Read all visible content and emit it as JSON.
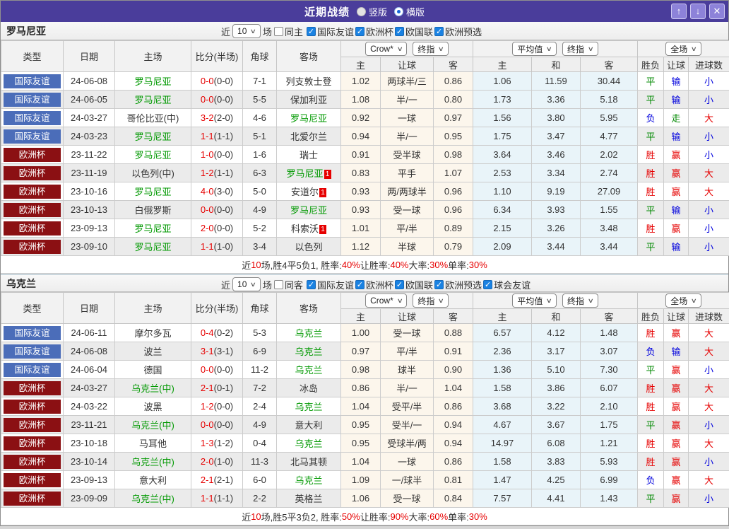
{
  "titlebar": {
    "title": "近期战绩",
    "vertical_label": "竖版",
    "horizontal_label": "横版",
    "icons": {
      "up": "↑",
      "down": "↓",
      "close": "✕"
    }
  },
  "colors": {
    "titlebar_purple": "#4a3d9b",
    "friendly_blue": "#4b6db9",
    "eurocup_darkred": "#8b1013",
    "team_green": "#009900",
    "win_red": "#e60000",
    "lose_blue": "#0000dd",
    "draw_green": "#008800",
    "handicap_tint": "#fcf6ec",
    "average_tint": "#e9f4f9"
  },
  "table_header": {
    "col_type": "类型",
    "col_date": "日期",
    "col_home": "主场",
    "col_score": "比分(半场)",
    "col_corner": "角球",
    "col_away": "客场",
    "dd_book": "Crow*",
    "dd_final1": "终指",
    "dd_avg": "平均值",
    "dd_final2": "终指",
    "dd_scope": "全场",
    "sub_home": "主",
    "sub_handicap": "让球",
    "sub_away": "客",
    "sub_avg_home": "主",
    "sub_avg_draw": "和",
    "sub_avg_away": "客",
    "sub_wdl": "胜负",
    "sub_ah": "让球",
    "sub_goals": "进球数"
  },
  "sections": [
    {
      "team": "罗马尼亚",
      "filter": {
        "near_label": "近",
        "count": "10",
        "games_label": "场",
        "same_label": "同主",
        "competitions": [
          "国际友谊",
          "欧洲杯",
          "欧国联",
          "欧洲预选"
        ]
      },
      "rows": [
        {
          "comp": "国际友谊",
          "comp_style": "friendly",
          "date": "24-06-08",
          "home": "罗马尼亚",
          "home_hl": true,
          "away": "列支敦士登",
          "away_hl": false,
          "ft": "0-0",
          "ht": "(0-0)",
          "corner": "7-1",
          "oh": "1.02",
          "hc": "两球半/三",
          "oa": "0.86",
          "ah": "1.06",
          "ad": "11.59",
          "aa": "30.44",
          "wdl": "平",
          "wdl_c": "g",
          "rah": "输",
          "rah_c": "b",
          "ou": "小",
          "ou_c": "b"
        },
        {
          "comp": "国际友谊",
          "comp_style": "friendly",
          "date": "24-06-05",
          "home": "罗马尼亚",
          "home_hl": true,
          "away": "保加利亚",
          "away_hl": false,
          "ft": "0-0",
          "ht": "(0-0)",
          "corner": "5-5",
          "oh": "1.08",
          "hc": "半/一",
          "oa": "0.80",
          "ah": "1.73",
          "ad": "3.36",
          "aa": "5.18",
          "wdl": "平",
          "wdl_c": "g",
          "rah": "输",
          "rah_c": "b",
          "ou": "小",
          "ou_c": "b"
        },
        {
          "comp": "国际友谊",
          "comp_style": "friendly",
          "date": "24-03-27",
          "home": "哥伦比亚(中)",
          "home_hl": false,
          "away": "罗马尼亚",
          "away_hl": true,
          "ft": "3-2",
          "ht": "(2-0)",
          "corner": "4-6",
          "oh": "0.92",
          "hc": "一球",
          "oa": "0.97",
          "ah": "1.56",
          "ad": "3.80",
          "aa": "5.95",
          "wdl": "负",
          "wdl_c": "b",
          "rah": "走",
          "rah_c": "g",
          "ou": "大",
          "ou_c": "r"
        },
        {
          "comp": "国际友谊",
          "comp_style": "friendly",
          "date": "24-03-23",
          "home": "罗马尼亚",
          "home_hl": true,
          "away": "北爱尔兰",
          "away_hl": false,
          "ft": "1-1",
          "ht": "(1-1)",
          "corner": "5-1",
          "oh": "0.94",
          "hc": "半/一",
          "oa": "0.95",
          "ah": "1.75",
          "ad": "3.47",
          "aa": "4.77",
          "wdl": "平",
          "wdl_c": "g",
          "rah": "输",
          "rah_c": "b",
          "ou": "小",
          "ou_c": "b"
        },
        {
          "comp": "欧洲杯",
          "comp_style": "euro",
          "date": "23-11-22",
          "home": "罗马尼亚",
          "home_hl": true,
          "away": "瑞士",
          "away_hl": false,
          "ft": "1-0",
          "ht": "(0-0)",
          "corner": "1-6",
          "oh": "0.91",
          "hc": "受半球",
          "oa": "0.98",
          "ah": "3.64",
          "ad": "3.46",
          "aa": "2.02",
          "wdl": "胜",
          "wdl_c": "r",
          "rah": "赢",
          "rah_c": "r",
          "ou": "小",
          "ou_c": "b"
        },
        {
          "comp": "欧洲杯",
          "comp_style": "euro",
          "date": "23-11-19",
          "home": "以色列(中)",
          "home_hl": false,
          "away": "罗马尼亚",
          "away_hl": true,
          "away_card": "1",
          "ft": "1-2",
          "ht": "(1-1)",
          "corner": "6-3",
          "oh": "0.83",
          "hc": "平手",
          "oa": "1.07",
          "ah": "2.53",
          "ad": "3.34",
          "aa": "2.74",
          "wdl": "胜",
          "wdl_c": "r",
          "rah": "赢",
          "rah_c": "r",
          "ou": "大",
          "ou_c": "r"
        },
        {
          "comp": "欧洲杯",
          "comp_style": "euro",
          "date": "23-10-16",
          "home": "罗马尼亚",
          "home_hl": true,
          "away": "安道尔",
          "away_hl": false,
          "away_card": "1",
          "ft": "4-0",
          "ht": "(3-0)",
          "corner": "5-0",
          "oh": "0.93",
          "hc": "两/两球半",
          "oa": "0.96",
          "ah": "1.10",
          "ad": "9.19",
          "aa": "27.09",
          "wdl": "胜",
          "wdl_c": "r",
          "rah": "赢",
          "rah_c": "r",
          "ou": "大",
          "ou_c": "r"
        },
        {
          "comp": "欧洲杯",
          "comp_style": "euro",
          "date": "23-10-13",
          "home": "白俄罗斯",
          "home_hl": false,
          "away": "罗马尼亚",
          "away_hl": true,
          "ft": "0-0",
          "ht": "(0-0)",
          "corner": "4-9",
          "oh": "0.93",
          "hc": "受一球",
          "oa": "0.96",
          "ah": "6.34",
          "ad": "3.93",
          "aa": "1.55",
          "wdl": "平",
          "wdl_c": "g",
          "rah": "输",
          "rah_c": "b",
          "ou": "小",
          "ou_c": "b"
        },
        {
          "comp": "欧洲杯",
          "comp_style": "euro",
          "date": "23-09-13",
          "home": "罗马尼亚",
          "home_hl": true,
          "away": "科索沃",
          "away_hl": false,
          "away_card": "1",
          "ft": "2-0",
          "ht": "(0-0)",
          "corner": "5-2",
          "oh": "1.01",
          "hc": "平/半",
          "oa": "0.89",
          "ah": "2.15",
          "ad": "3.26",
          "aa": "3.48",
          "wdl": "胜",
          "wdl_c": "r",
          "rah": "赢",
          "rah_c": "r",
          "ou": "小",
          "ou_c": "b"
        },
        {
          "comp": "欧洲杯",
          "comp_style": "euro",
          "date": "23-09-10",
          "home": "罗马尼亚",
          "home_hl": true,
          "away": "以色列",
          "away_hl": false,
          "ft": "1-1",
          "ht": "(1-0)",
          "corner": "3-4",
          "oh": "1.12",
          "hc": "半球",
          "oa": "0.79",
          "ah": "2.09",
          "ad": "3.44",
          "aa": "3.44",
          "wdl": "平",
          "wdl_c": "g",
          "rah": "输",
          "rah_c": "b",
          "ou": "小",
          "ou_c": "b"
        }
      ],
      "summary": [
        [
          "近",
          "k"
        ],
        [
          "10",
          "r"
        ],
        [
          "场,胜4平5负1, 胜率:",
          "k"
        ],
        [
          "40%",
          "r"
        ],
        [
          " 让胜率:",
          "k"
        ],
        [
          "40%",
          "r"
        ],
        [
          " 大率:",
          "k"
        ],
        [
          "30%",
          "r"
        ],
        [
          " 单率:",
          "k"
        ],
        [
          "30%",
          "r"
        ]
      ]
    },
    {
      "team": "乌克兰",
      "filter": {
        "near_label": "近",
        "count": "10",
        "games_label": "场",
        "same_label": "同客",
        "competitions": [
          "国际友谊",
          "欧洲杯",
          "欧国联",
          "欧洲预选",
          "球会友谊"
        ]
      },
      "rows": [
        {
          "comp": "国际友谊",
          "comp_style": "friendly",
          "date": "24-06-11",
          "home": "摩尔多瓦",
          "home_hl": false,
          "away": "乌克兰",
          "away_hl": true,
          "ft": "0-4",
          "ht": "(0-2)",
          "corner": "5-3",
          "oh": "1.00",
          "hc": "受一球",
          "oa": "0.88",
          "ah": "6.57",
          "ad": "4.12",
          "aa": "1.48",
          "wdl": "胜",
          "wdl_c": "r",
          "rah": "赢",
          "rah_c": "r",
          "ou": "大",
          "ou_c": "r"
        },
        {
          "comp": "国际友谊",
          "comp_style": "friendly",
          "date": "24-06-08",
          "home": "波兰",
          "home_hl": false,
          "away": "乌克兰",
          "away_hl": true,
          "ft": "3-1",
          "ht": "(3-1)",
          "corner": "6-9",
          "oh": "0.97",
          "hc": "平/半",
          "oa": "0.91",
          "ah": "2.36",
          "ad": "3.17",
          "aa": "3.07",
          "wdl": "负",
          "wdl_c": "b",
          "rah": "输",
          "rah_c": "b",
          "ou": "大",
          "ou_c": "r"
        },
        {
          "comp": "国际友谊",
          "comp_style": "friendly",
          "date": "24-06-04",
          "home": "德国",
          "home_hl": false,
          "away": "乌克兰",
          "away_hl": true,
          "ft": "0-0",
          "ht": "(0-0)",
          "corner": "11-2",
          "oh": "0.98",
          "hc": "球半",
          "oa": "0.90",
          "ah": "1.36",
          "ad": "5.10",
          "aa": "7.30",
          "wdl": "平",
          "wdl_c": "g",
          "rah": "赢",
          "rah_c": "r",
          "ou": "小",
          "ou_c": "b"
        },
        {
          "comp": "欧洲杯",
          "comp_style": "euro",
          "date": "24-03-27",
          "home": "乌克兰(中)",
          "home_hl": true,
          "away": "冰岛",
          "away_hl": false,
          "ft": "2-1",
          "ht": "(0-1)",
          "corner": "7-2",
          "oh": "0.86",
          "hc": "半/一",
          "oa": "1.04",
          "ah": "1.58",
          "ad": "3.86",
          "aa": "6.07",
          "wdl": "胜",
          "wdl_c": "r",
          "rah": "赢",
          "rah_c": "r",
          "ou": "大",
          "ou_c": "r"
        },
        {
          "comp": "欧洲杯",
          "comp_style": "euro",
          "date": "24-03-22",
          "home": "波黑",
          "home_hl": false,
          "away": "乌克兰",
          "away_hl": true,
          "ft": "1-2",
          "ht": "(0-0)",
          "corner": "2-4",
          "oh": "1.04",
          "hc": "受平/半",
          "oa": "0.86",
          "ah": "3.68",
          "ad": "3.22",
          "aa": "2.10",
          "wdl": "胜",
          "wdl_c": "r",
          "rah": "赢",
          "rah_c": "r",
          "ou": "大",
          "ou_c": "r"
        },
        {
          "comp": "欧洲杯",
          "comp_style": "euro",
          "date": "23-11-21",
          "home": "乌克兰(中)",
          "home_hl": true,
          "away": "意大利",
          "away_hl": false,
          "ft": "0-0",
          "ht": "(0-0)",
          "corner": "4-9",
          "oh": "0.95",
          "hc": "受半/一",
          "oa": "0.94",
          "ah": "4.67",
          "ad": "3.67",
          "aa": "1.75",
          "wdl": "平",
          "wdl_c": "g",
          "rah": "赢",
          "rah_c": "r",
          "ou": "小",
          "ou_c": "b"
        },
        {
          "comp": "欧洲杯",
          "comp_style": "euro",
          "date": "23-10-18",
          "home": "马耳他",
          "home_hl": false,
          "away": "乌克兰",
          "away_hl": true,
          "ft": "1-3",
          "ht": "(1-2)",
          "corner": "0-4",
          "oh": "0.95",
          "hc": "受球半/两",
          "oa": "0.94",
          "ah": "14.97",
          "ad": "6.08",
          "aa": "1.21",
          "wdl": "胜",
          "wdl_c": "r",
          "rah": "赢",
          "rah_c": "r",
          "ou": "大",
          "ou_c": "r"
        },
        {
          "comp": "欧洲杯",
          "comp_style": "euro",
          "date": "23-10-14",
          "home": "乌克兰(中)",
          "home_hl": true,
          "away": "北马其顿",
          "away_hl": false,
          "ft": "2-0",
          "ht": "(1-0)",
          "corner": "11-3",
          "oh": "1.04",
          "hc": "一球",
          "oa": "0.86",
          "ah": "1.58",
          "ad": "3.83",
          "aa": "5.93",
          "wdl": "胜",
          "wdl_c": "r",
          "rah": "赢",
          "rah_c": "r",
          "ou": "小",
          "ou_c": "b"
        },
        {
          "comp": "欧洲杯",
          "comp_style": "euro",
          "date": "23-09-13",
          "home": "意大利",
          "home_hl": false,
          "away": "乌克兰",
          "away_hl": true,
          "ft": "2-1",
          "ht": "(2-1)",
          "corner": "6-0",
          "oh": "1.09",
          "hc": "一/球半",
          "oa": "0.81",
          "ah": "1.47",
          "ad": "4.25",
          "aa": "6.99",
          "wdl": "负",
          "wdl_c": "b",
          "rah": "赢",
          "rah_c": "r",
          "ou": "大",
          "ou_c": "r"
        },
        {
          "comp": "欧洲杯",
          "comp_style": "euro",
          "date": "23-09-09",
          "home": "乌克兰(中)",
          "home_hl": true,
          "away": "英格兰",
          "away_hl": false,
          "ft": "1-1",
          "ht": "(1-1)",
          "corner": "2-2",
          "oh": "1.06",
          "hc": "受一球",
          "oa": "0.84",
          "ah": "7.57",
          "ad": "4.41",
          "aa": "1.43",
          "wdl": "平",
          "wdl_c": "g",
          "rah": "赢",
          "rah_c": "r",
          "ou": "小",
          "ou_c": "b"
        }
      ],
      "summary": [
        [
          "近",
          "k"
        ],
        [
          "10",
          "r"
        ],
        [
          "场,胜5平3负2, 胜率:",
          "k"
        ],
        [
          "50%",
          "r"
        ],
        [
          " 让胜率:",
          "k"
        ],
        [
          "90%",
          "r"
        ],
        [
          " 大率:",
          "k"
        ],
        [
          "60%",
          "r"
        ],
        [
          " 单率:",
          "k"
        ],
        [
          "30%",
          "r"
        ]
      ]
    }
  ]
}
